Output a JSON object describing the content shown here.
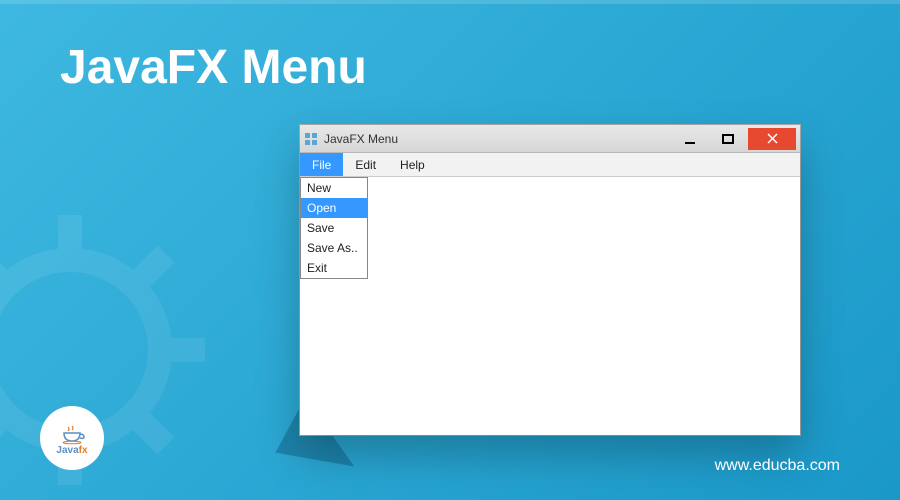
{
  "page": {
    "title": "JavaFX Menu",
    "site": "www.educba.com"
  },
  "logo": {
    "java": "Java",
    "fx": "fx"
  },
  "window": {
    "title": "JavaFX Menu",
    "menubar": [
      {
        "label": "File",
        "active": true
      },
      {
        "label": "Edit",
        "active": false
      },
      {
        "label": "Help",
        "active": false
      }
    ],
    "dropdown": {
      "items": [
        {
          "label": "New",
          "hover": false
        },
        {
          "label": "Open",
          "hover": true
        },
        {
          "label": "Save",
          "hover": false
        },
        {
          "label": "Save As..",
          "hover": false
        },
        {
          "label": "Exit",
          "hover": false
        }
      ]
    }
  }
}
